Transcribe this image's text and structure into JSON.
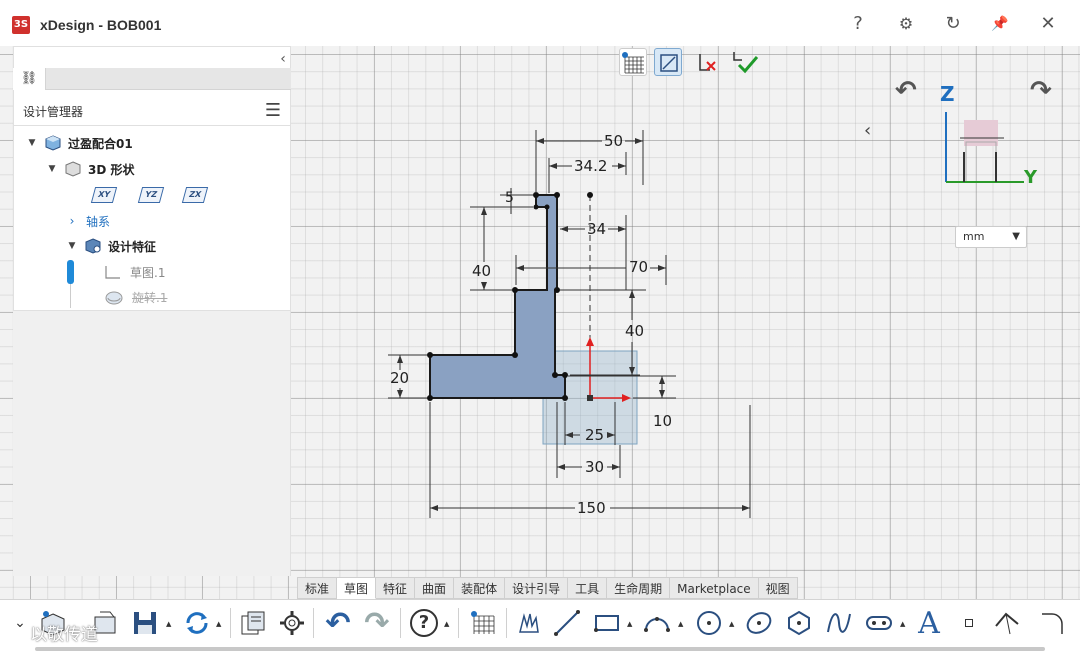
{
  "app": {
    "title": "xDesign - BOB001",
    "logo_text": "3S"
  },
  "title_buttons": {
    "help": "?",
    "settings": "⚙",
    "refresh": "↻",
    "pin": "📌",
    "close": "✕"
  },
  "panel": {
    "collapse": "‹",
    "tab_icon": "⛓",
    "header": "设计管理器",
    "menu": "☰",
    "tree": {
      "root": "过盈配合01",
      "shapes": "3D 形状",
      "planes": [
        "XY",
        "YZ",
        "ZX"
      ],
      "axes": "轴系",
      "features": "设计特征",
      "sketch": "草图.1",
      "revolve": "旋转.1"
    }
  },
  "viewcube": {
    "z_label": "Z",
    "y_label": "Y",
    "rotate_left": "↶",
    "rotate_right": "↷",
    "expand": "‹"
  },
  "units": {
    "value": "mm",
    "arrow": "▼"
  },
  "dimensions": {
    "d50": "50",
    "d34_2": "34.2",
    "d5": "5",
    "d34": "34",
    "d40_left": "40",
    "d70": "70",
    "d40_right": "40",
    "d20": "20",
    "d10": "10",
    "d25": "25",
    "d30": "30",
    "d150": "150"
  },
  "tabs": [
    "标准",
    "草图",
    "特征",
    "曲面",
    "装配体",
    "设计引导",
    "工具",
    "生命周期",
    "Marketplace",
    "视图"
  ],
  "active_tab": "草图",
  "toolbar": {
    "undo": "↶",
    "redo": "↷",
    "help": "?",
    "text": "A",
    "dropdown": "⌄"
  },
  "watermark": "以敬传道",
  "colors": {
    "accent": "#1f6fbf",
    "sketch_fill": "#7a93b6",
    "axis_red": "#e02020"
  }
}
